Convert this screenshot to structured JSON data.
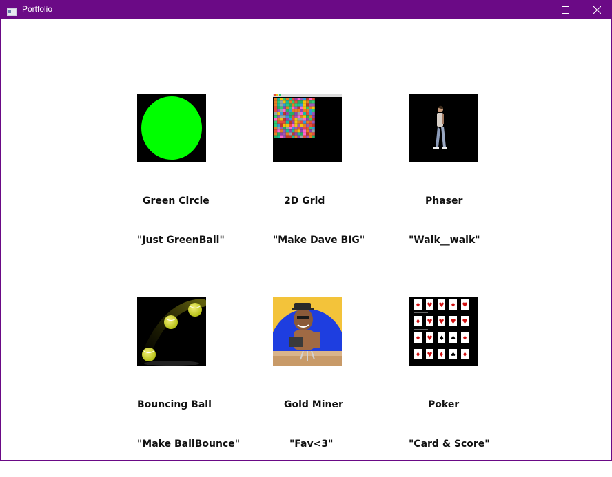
{
  "window": {
    "title": "Portfolio"
  },
  "controls": {
    "minimize": "minimize-icon",
    "maximize": "maximize-icon",
    "close": "close-icon"
  },
  "colors": {
    "titlebar": "#6b0a86",
    "green": "#00ff00",
    "tennis": "#c8d21e",
    "sky": "#1e3ee0",
    "sun": "#f3c33a"
  },
  "projects": [
    {
      "name": "Green Circle",
      "subtitle": "\"Just GreenBall\""
    },
    {
      "name": "2D Grid",
      "subtitle": "\"Make Dave BIG\""
    },
    {
      "name": "Phaser",
      "subtitle": "\"Walk__walk\""
    },
    {
      "name": "Bouncing Ball",
      "subtitle": "\"Make BallBounce\""
    },
    {
      "name": "Gold Miner",
      "subtitle": "\"Fav<3\""
    },
    {
      "name": "Poker",
      "subtitle": "\"Card & Score\""
    }
  ]
}
